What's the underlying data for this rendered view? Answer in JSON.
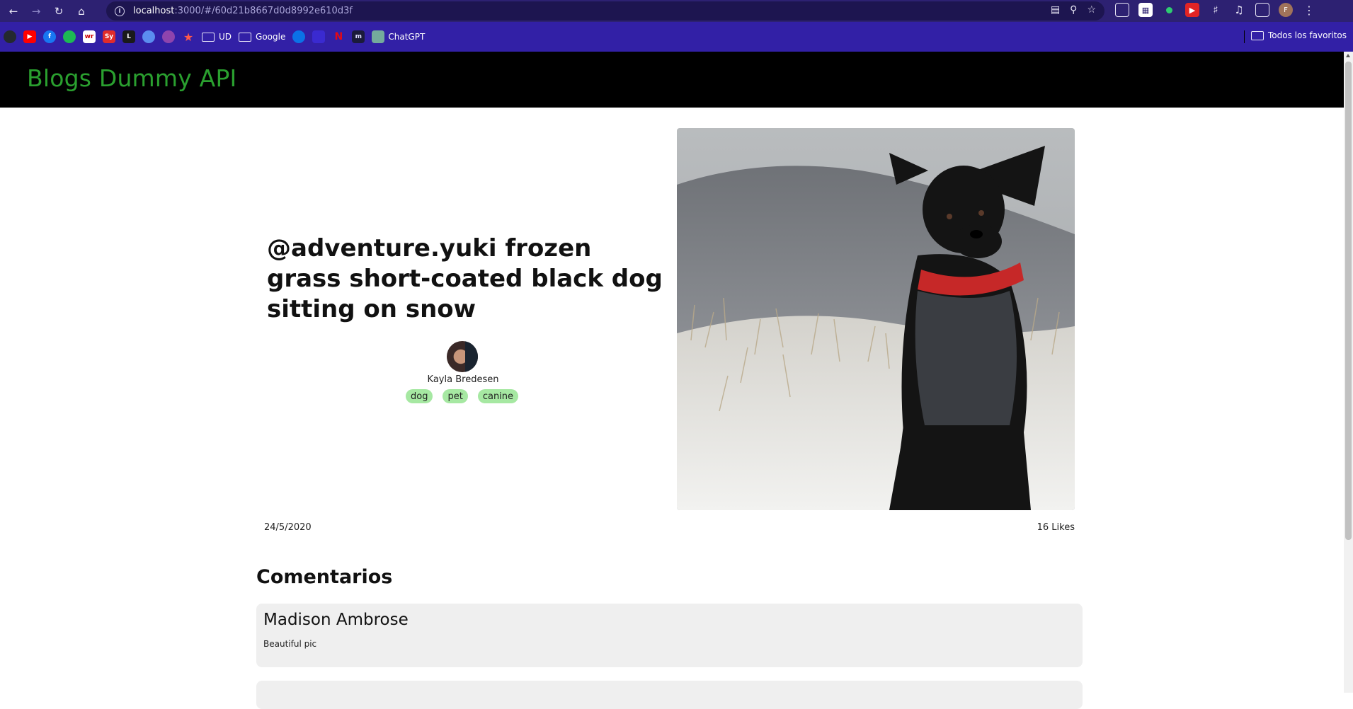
{
  "browser": {
    "url_host": "localhost",
    "url_path": ":3000/#/60d21b8667d0d8992e610d3f",
    "profile_initial": "F",
    "bookmarks": [
      {
        "label": "UD",
        "type": "folder"
      },
      {
        "label": "Google",
        "type": "folder"
      },
      {
        "label": "ChatGPT",
        "type": "link"
      }
    ],
    "all_bookmarks_label": "Todos los favoritos"
  },
  "site": {
    "title": "Blogs Dummy API"
  },
  "post": {
    "title": "@adventure.yuki frozen grass short-coated black dog sitting on snow",
    "author": "Kayla Bredesen",
    "tags": [
      "dog",
      "pet",
      "canine"
    ],
    "date": "24/5/2020",
    "likes": "16 Likes",
    "image_alt": "short-coated black dog sitting on snow"
  },
  "comments": {
    "heading": "Comentarios",
    "items": [
      {
        "author": "Madison Ambrose",
        "text": "Beautiful pic"
      },
      {
        "author": "",
        "text": ""
      }
    ]
  }
}
